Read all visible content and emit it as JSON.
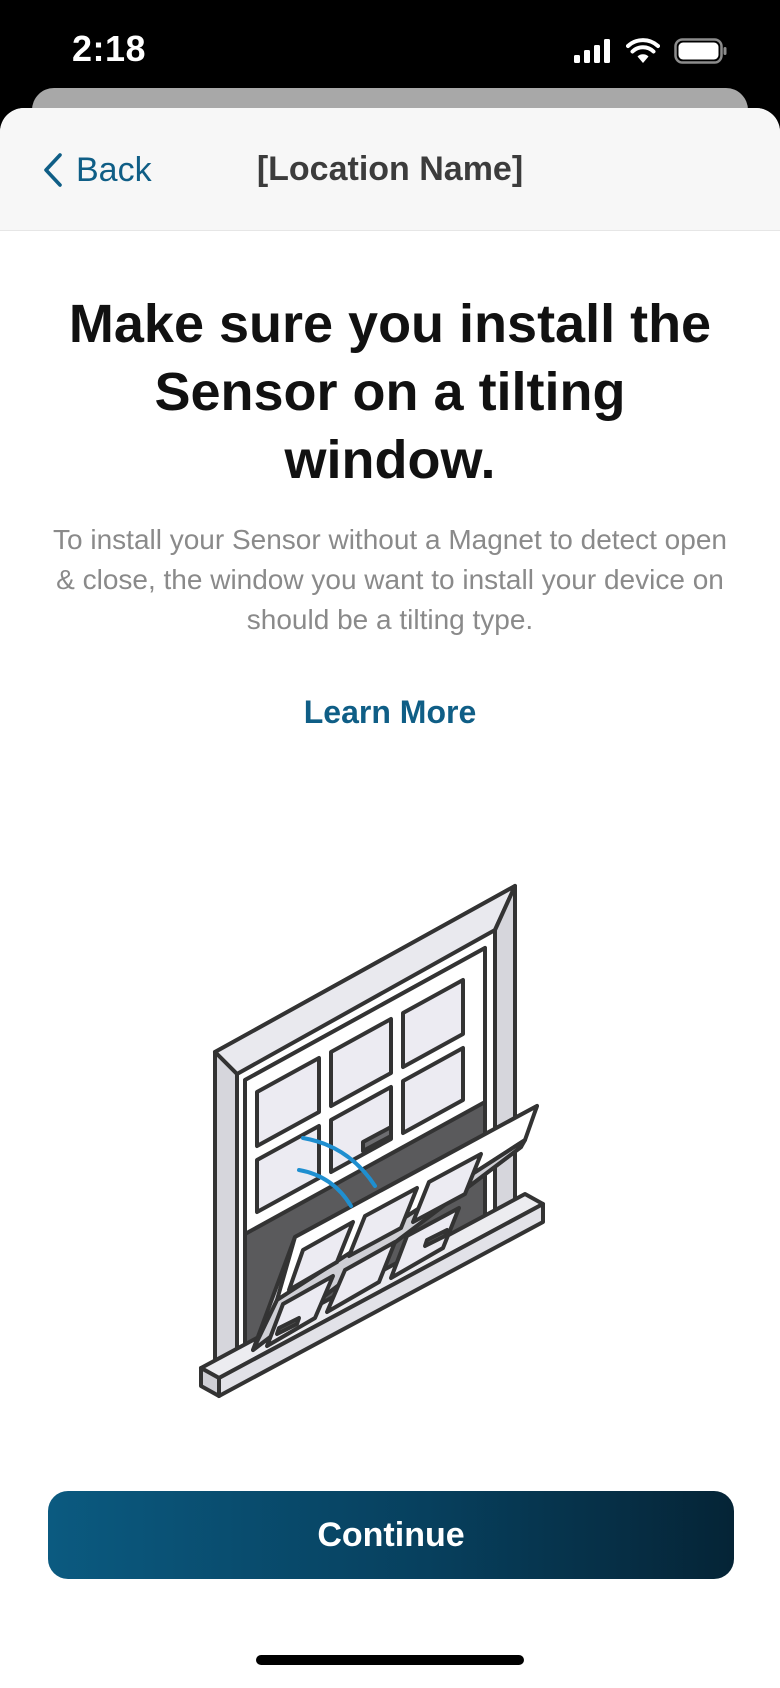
{
  "status_bar": {
    "time": "2:18",
    "icons": [
      "cellular-signal-icon",
      "wifi-icon",
      "battery-icon"
    ]
  },
  "nav": {
    "back_label": "Back",
    "title": "[Location Name]"
  },
  "content": {
    "headline": "Make sure you install the Sensor on a tilting window.",
    "body": "To install your Sensor without a Magnet to detect open & close, the window you want to install your device on should be a tilting type.",
    "learn_more_label": "Learn More",
    "illustration": "tilting-window-illustration"
  },
  "footer": {
    "continue_label": "Continue"
  },
  "colors": {
    "accent": "#0f5e86",
    "button_gradient_start": "#0b5a80",
    "button_gradient_end": "#052436",
    "headline": "#111111",
    "body_text": "#8a8a8a",
    "signal_arcs": "#1f8fd0"
  }
}
